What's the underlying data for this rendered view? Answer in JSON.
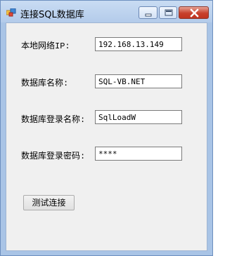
{
  "window": {
    "title": "连接SQL数据库",
    "icon": "app-window-icon"
  },
  "titlebar_buttons": {
    "minimize": "minimize-icon",
    "maximize": "maximize-icon",
    "close": "close-icon"
  },
  "form": {
    "ip_label": "本地网络IP:",
    "ip_value": "192.168.13.149",
    "db_name_label": "数据库名称:",
    "db_name_value": "SQL-VB.NET",
    "login_name_label": "数据库登录名称:",
    "login_name_value": "SqlLoadW",
    "password_label": "数据库登录密码:",
    "password_value": "****",
    "test_button_label": "测试连接"
  }
}
